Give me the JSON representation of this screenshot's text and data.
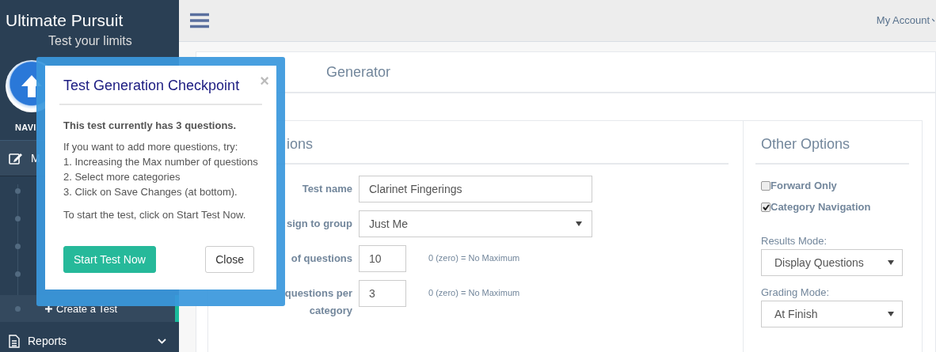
{
  "sidebar": {
    "brand": "Ultimate Pursuit",
    "tagline": "Test your limits",
    "nav_heading": "NAVI",
    "menu": [
      {
        "kind": "menu",
        "label": "M"
      },
      {
        "kind": "sub",
        "label": "Create a Test",
        "selected": true
      },
      {
        "kind": "menu",
        "label": "Reports",
        "expandable": true
      }
    ]
  },
  "topbar": {
    "account": "My Account"
  },
  "main": {
    "title": "Generator",
    "options": {
      "heading": "ions",
      "fields": [
        {
          "kind": "text",
          "label": "Test name",
          "value": "Clarinet Fingerings"
        },
        {
          "kind": "select",
          "label": "sign to group",
          "value": "Just Me"
        },
        {
          "kind": "number",
          "label": "of questions",
          "value": "10",
          "hint": "0 (zero) = No Maximum"
        },
        {
          "kind": "number",
          "label": "questions per category",
          "value": "3",
          "hint": "0 (zero) = No Maximum"
        }
      ]
    },
    "other_options": {
      "heading": "Other Options",
      "checkboxes": [
        {
          "label": "Forward Only",
          "checked": false
        },
        {
          "label": "Category Navigation",
          "checked": true
        }
      ],
      "selects": [
        {
          "label": "Results Mode:",
          "value": "Display Questions"
        },
        {
          "label": "Grading Mode:",
          "value": "At Finish"
        }
      ]
    }
  },
  "modal": {
    "title": "Test Generation Checkpoint",
    "close_symbol": "×",
    "summary": "This test currently has 3 questions.",
    "intro": "If you want to add more questions, try:",
    "steps": [
      "1. Increasing the Max number of questions",
      "2. Select more categories",
      "3. Click on Save Changes (at bottom)."
    ],
    "outro": "To start the test, click on Start Test Now.",
    "buttons": [
      {
        "kind": "primary",
        "label": "Start Test Now"
      },
      {
        "kind": "default",
        "label": "Close"
      }
    ]
  }
}
